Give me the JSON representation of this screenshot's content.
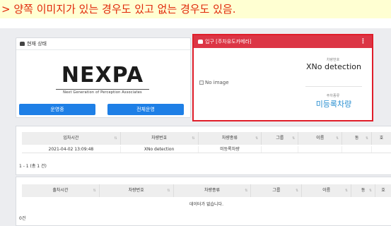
{
  "caption": "> 양쪽 이미지가 있는 경우도 있고 없는 경우도 있음.",
  "status_panel": {
    "title": "현재 상태",
    "logo_word": "NEXPA",
    "logo_tagline": "Next Generation of Perception Associates",
    "buttons": [
      "운영중",
      "전체운영"
    ]
  },
  "entrance_panel": {
    "title": "입구 [주차유도카메라]",
    "menu": "⋮",
    "image_alt": "No image",
    "plate_label": "차량번호",
    "plate_value": "XNo detection",
    "type_label": "주차종류",
    "type_value": "미등록차량"
  },
  "entry_table": {
    "headers": [
      "입차시간",
      "차량번호",
      "차량종류",
      "그룹",
      "이름",
      "동",
      "호"
    ],
    "rows": [
      [
        "2021-04-02 13:09:48",
        "XNo detection",
        "미등록차량",
        "",
        "",
        "",
        ""
      ]
    ],
    "footer": "1 - 1 (총 1 건)"
  },
  "exit_table": {
    "headers": [
      "출차시간",
      "차량번호",
      "차량종류",
      "그룹",
      "이름",
      "동",
      "호"
    ],
    "empty_message": "데이터가 없습니다.",
    "footer": "0건"
  },
  "colors": {
    "caption_bg": "#ffffd2",
    "caption_text": "#e0280a",
    "primary": "#1e7fe6",
    "danger": "#dc3545",
    "type_text": "#2a8fd1"
  }
}
